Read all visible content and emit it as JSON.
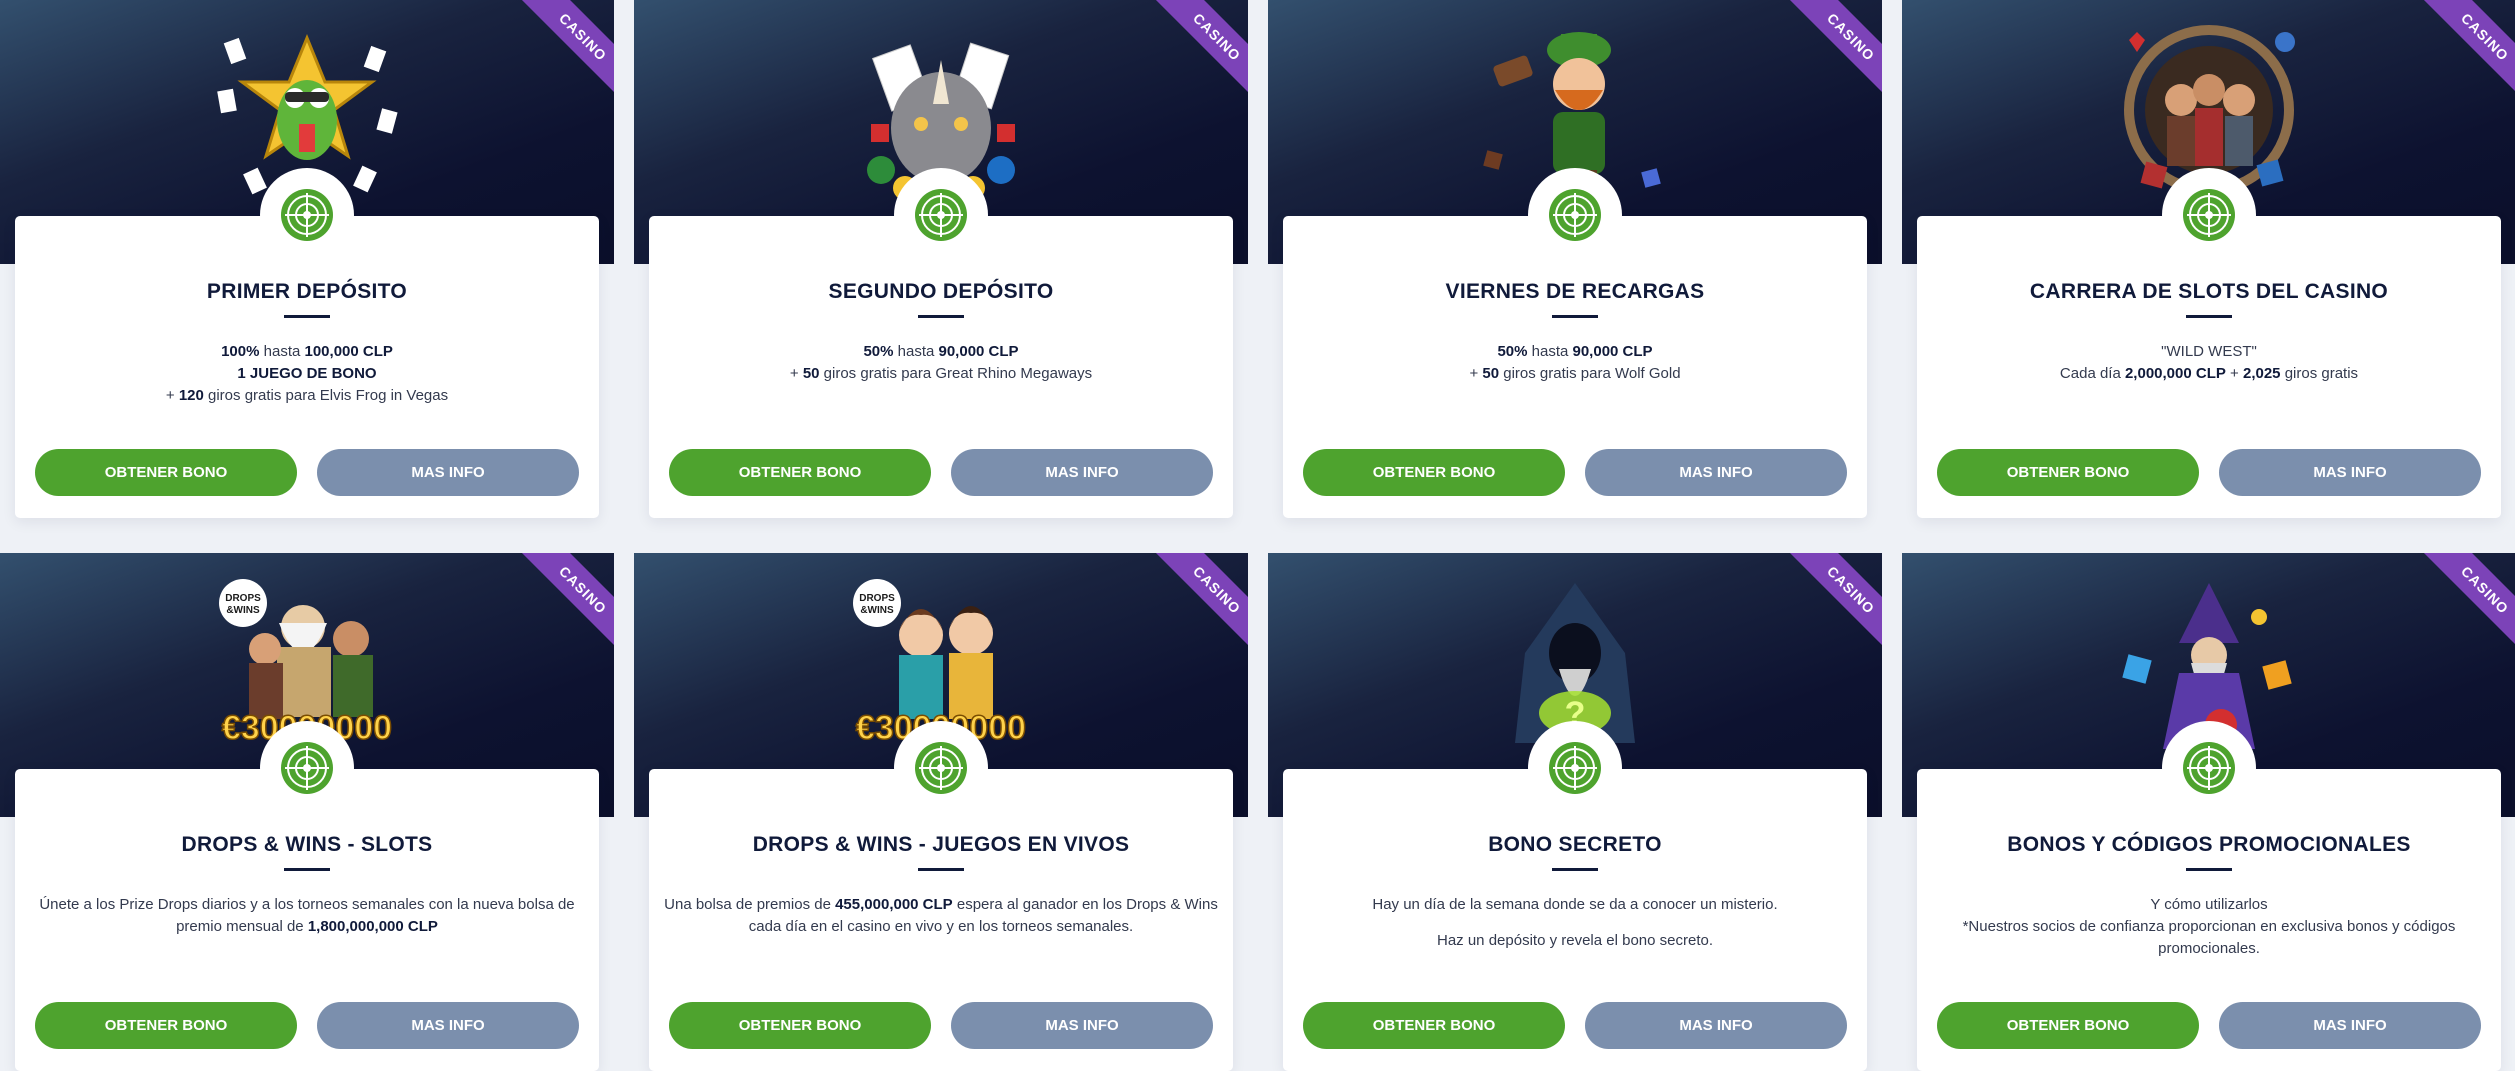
{
  "cards": [
    {
      "ribbon": "CASINO",
      "art": "frog-character-with-playing-cards",
      "title": "PRIMER DEPÓSITO",
      "lines": [
        [
          {
            "t": "100%",
            "b": true
          },
          {
            "t": " hasta "
          },
          {
            "t": "100,000 CLP",
            "b": true
          }
        ],
        [
          {
            "t": "1 JUEGO DE BONO",
            "b": true
          }
        ],
        [
          {
            "t": "+ "
          },
          {
            "t": "120",
            "b": true
          },
          {
            "t": " giros gratis para Elvis Frog in Vegas"
          }
        ]
      ],
      "primary_label": "OBTENER BONO",
      "secondary_label": "MAS INFO"
    },
    {
      "ribbon": "CASINO",
      "art": "rhino-with-cards-and-chips",
      "title": "SEGUNDO DEPÓSITO",
      "lines": [
        [
          {
            "t": "50%",
            "b": true
          },
          {
            "t": " hasta "
          },
          {
            "t": "90,000 CLP",
            "b": true
          }
        ],
        [
          {
            "t": "+ "
          },
          {
            "t": "50",
            "b": true
          },
          {
            "t": " giros gratis para Great Rhino Megaways"
          }
        ]
      ],
      "primary_label": "OBTENER BONO",
      "secondary_label": "MAS INFO"
    },
    {
      "ribbon": "CASINO",
      "art": "leprechaun-with-dice",
      "title": "VIERNES DE RECARGAS",
      "lines": [
        [
          {
            "t": "50%",
            "b": true
          },
          {
            "t": " hasta "
          },
          {
            "t": "90,000 CLP",
            "b": true
          }
        ],
        [
          {
            "t": "+ "
          },
          {
            "t": "50",
            "b": true
          },
          {
            "t": " giros gratis para Wolf Gold"
          }
        ]
      ],
      "primary_label": "OBTENER BONO",
      "secondary_label": "MAS INFO"
    },
    {
      "ribbon": "CASINO",
      "art": "wild-west-cowboys-wheel",
      "title": "CARRERA DE SLOTS DEL CASINO",
      "lines": [
        [
          {
            "t": "\"WILD WEST\""
          }
        ],
        [
          {
            "t": "Cada día "
          },
          {
            "t": "2,000,000 CLP",
            "b": true
          },
          {
            "t": " + "
          },
          {
            "t": "2,025",
            "b": true
          },
          {
            "t": " giros gratis"
          }
        ]
      ],
      "primary_label": "OBTENER BONO",
      "secondary_label": "MAS INFO"
    },
    {
      "ribbon": "CASINO",
      "art": "drops-and-wins-slots-heroes",
      "art_logo": "DROPS &WINS",
      "art_amount": "€30000000",
      "title": "DROPS & WINS - SLOTS",
      "lines": [
        [
          {
            "t": "Únete a los Prize Drops diarios y a los torneos semanales con la nueva bolsa de premio mensual de "
          },
          {
            "t": "1,800,000,000 CLP",
            "b": true
          }
        ]
      ],
      "primary_label": "OBTENER BONO",
      "secondary_label": "MAS INFO"
    },
    {
      "ribbon": "CASINO",
      "art": "drops-and-wins-live-dealers",
      "art_logo": "DROPS &WINS",
      "art_amount": "€30000000",
      "title": "DROPS & WINS - JUEGOS EN VIVOS",
      "lines": [
        [
          {
            "t": "Una bolsa de premios de "
          },
          {
            "t": "455,000,000 CLP",
            "b": true
          },
          {
            "t": " espera al ganador en los Drops & Wins cada día en el casino en vivo y en los torneos semanales."
          }
        ]
      ],
      "primary_label": "OBTENER BONO",
      "secondary_label": "MAS INFO"
    },
    {
      "ribbon": "CASINO",
      "art": "hooded-wizard-with-question-mark",
      "title": "BONO SECRETO",
      "paragraphs": [
        [
          {
            "t": "Hay un día de la semana donde se da a conocer un misterio."
          }
        ],
        [
          {
            "t": "Haz un depósito y revela el bono secreto."
          }
        ]
      ],
      "primary_label": "OBTENER BONO",
      "secondary_label": "MAS INFO"
    },
    {
      "ribbon": "CASINO",
      "art": "wizard-with-gems",
      "title": "BONOS Y CÓDIGOS PROMOCIONALES",
      "lines": [
        [
          {
            "t": "Y cómo utilizarlos"
          }
        ],
        [
          {
            "t": "*Nuestros socios de confianza proporcionan en exclusiva bonos y códigos promocionales."
          }
        ]
      ],
      "primary_label": "OBTENER BONO",
      "secondary_label": "MAS INFO"
    }
  ],
  "colors": {
    "primary_button": "#4ea32e",
    "secondary_button": "#7b8fad",
    "ribbon": "#7c43b8",
    "badge_icon": "#4ea32e"
  },
  "badge_icon": "roulette-icon"
}
